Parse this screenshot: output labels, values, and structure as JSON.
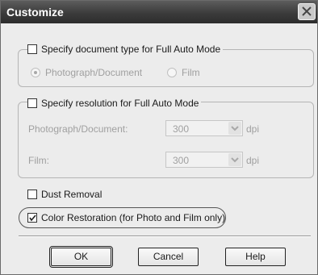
{
  "dialog": {
    "title": "Customize"
  },
  "doc_type_group": {
    "checkbox_label": "Specify document type for Full Auto Mode",
    "checked": false,
    "options": [
      {
        "label": "Photograph/Document",
        "selected": true
      },
      {
        "label": "Film",
        "selected": false
      }
    ]
  },
  "resolution_group": {
    "checkbox_label": "Specify resolution for Full Auto Mode",
    "checked": false,
    "rows": [
      {
        "label": "Photograph/Document:",
        "value": "300",
        "unit": "dpi"
      },
      {
        "label": "Film:",
        "value": "300",
        "unit": "dpi"
      }
    ]
  },
  "dust_removal": {
    "label": "Dust Removal",
    "checked": false
  },
  "color_restoration": {
    "label": "Color Restoration (for Photo and Film only)",
    "checked": true
  },
  "buttons": {
    "ok": "OK",
    "cancel": "Cancel",
    "help": "Help"
  },
  "colors": {
    "title_bar": "#3c3c3c",
    "dialog_bg": "#ececec",
    "disabled_text": "#a0a0a0"
  }
}
